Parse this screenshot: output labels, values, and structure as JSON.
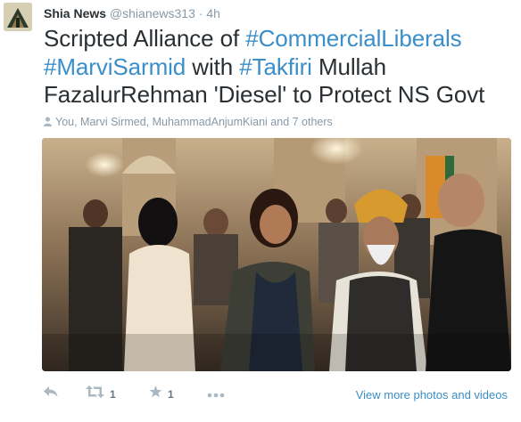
{
  "tweet": {
    "display_name": "Shia News",
    "handle": "@shianews313",
    "separator": "·",
    "time": "4h",
    "text": {
      "line1_plain": "Scripted Alliance of ",
      "line1_tag": "#CommercialLiberals",
      "line2_tag1": "#MarviSarmid",
      "line2_plain1": " with ",
      "line2_tag2": "#Takfiri",
      "line2_plain2": " Mullah",
      "line3_plain": "FazalurRehman 'Diesel' to Protect NS Govt"
    },
    "context": "You, Marvi Sirmed, MuhammadAnjumKiani and 7 others",
    "retweet_count": "1",
    "favorite_count": "1",
    "view_more_label": "View more photos and videos",
    "colors": {
      "link": "#3a8ec9",
      "text": "#292f33",
      "muted": "#8899a6",
      "action_icon": "#aab8c2"
    },
    "icons": [
      "person-icon",
      "reply-icon",
      "retweet-icon",
      "favorite-star-icon",
      "more-dots-icon"
    ]
  }
}
